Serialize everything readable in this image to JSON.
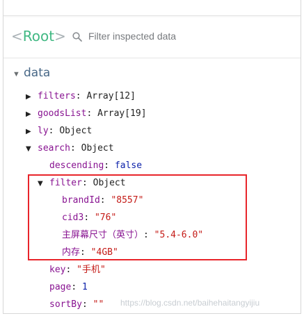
{
  "header": {
    "root_open": "<",
    "root_name": "Root",
    "root_close": ">",
    "filter_placeholder": "Filter inspected data"
  },
  "section": {
    "arrow": "▼",
    "title": "data"
  },
  "tree": [
    {
      "key": "filters",
      "value": "Array[12]",
      "value_type": "object",
      "arrow": "▶"
    },
    {
      "key": "goodsList",
      "value": "Array[19]",
      "value_type": "object",
      "arrow": "▶"
    },
    {
      "key": "ly",
      "value": "Object",
      "value_type": "object",
      "arrow": "▶"
    },
    {
      "key": "search",
      "value": "Object",
      "value_type": "object",
      "arrow": "▼"
    },
    {
      "key": "descending",
      "value": "false",
      "value_type": "boolean"
    },
    {
      "key": "filter",
      "value": "Object",
      "value_type": "object",
      "arrow": "▼"
    },
    {
      "key": "brandId",
      "value": "\"8557\"",
      "value_type": "string"
    },
    {
      "key": "cid3",
      "value": "\"76\"",
      "value_type": "string"
    },
    {
      "key": "主屏幕尺寸（英寸）",
      "value": "\"5.4-6.0\"",
      "value_type": "string"
    },
    {
      "key": "内存",
      "value": "\"4GB\"",
      "value_type": "string"
    },
    {
      "key": "key",
      "value": "\"手机\"",
      "value_type": "string"
    },
    {
      "key": "page",
      "value": "1",
      "value_type": "number"
    },
    {
      "key": "sortBy",
      "value": "\"\"",
      "value_type": "string"
    }
  ],
  "watermark": "https://blog.csdn.net/baihehaitangyijiu",
  "colors": {
    "vue_green": "#41b883",
    "key_purple": "#881391",
    "string_red": "#c41a16",
    "literal_blue": "#0d22aa",
    "section_blue": "#486887",
    "highlight_red": "#e8242a"
  }
}
